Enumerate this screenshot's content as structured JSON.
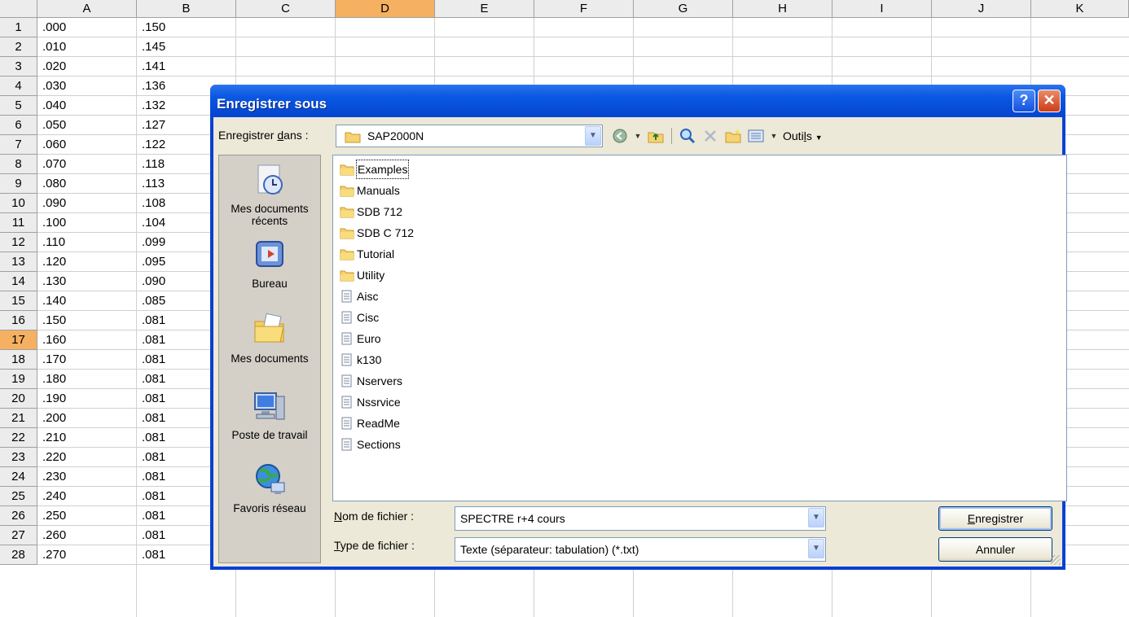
{
  "sheet": {
    "columns": [
      "A",
      "B",
      "C",
      "D",
      "E",
      "F",
      "G",
      "H",
      "I",
      "J",
      "K"
    ],
    "selected_column": "D",
    "selected_row": "17",
    "rows": [
      {
        "num": "1",
        "a": ".000",
        "b": ".150"
      },
      {
        "num": "2",
        "a": ".010",
        "b": ".145"
      },
      {
        "num": "3",
        "a": ".020",
        "b": ".141"
      },
      {
        "num": "4",
        "a": ".030",
        "b": ".136"
      },
      {
        "num": "5",
        "a": ".040",
        "b": ".132"
      },
      {
        "num": "6",
        "a": ".050",
        "b": ".127"
      },
      {
        "num": "7",
        "a": ".060",
        "b": ".122"
      },
      {
        "num": "8",
        "a": ".070",
        "b": ".118"
      },
      {
        "num": "9",
        "a": ".080",
        "b": ".113"
      },
      {
        "num": "10",
        "a": ".090",
        "b": ".108"
      },
      {
        "num": "11",
        "a": ".100",
        "b": ".104"
      },
      {
        "num": "12",
        "a": ".110",
        "b": ".099"
      },
      {
        "num": "13",
        "a": ".120",
        "b": ".095"
      },
      {
        "num": "14",
        "a": ".130",
        "b": ".090"
      },
      {
        "num": "15",
        "a": ".140",
        "b": ".085"
      },
      {
        "num": "16",
        "a": ".150",
        "b": ".081"
      },
      {
        "num": "17",
        "a": ".160",
        "b": ".081"
      },
      {
        "num": "18",
        "a": ".170",
        "b": ".081"
      },
      {
        "num": "19",
        "a": ".180",
        "b": ".081"
      },
      {
        "num": "20",
        "a": ".190",
        "b": ".081"
      },
      {
        "num": "21",
        "a": ".200",
        "b": ".081"
      },
      {
        "num": "22",
        "a": ".210",
        "b": ".081"
      },
      {
        "num": "23",
        "a": ".220",
        "b": ".081"
      },
      {
        "num": "24",
        "a": ".230",
        "b": ".081"
      },
      {
        "num": "25",
        "a": ".240",
        "b": ".081"
      },
      {
        "num": "26",
        "a": ".250",
        "b": ".081"
      },
      {
        "num": "27",
        "a": ".260",
        "b": ".081"
      },
      {
        "num": "28",
        "a": ".270",
        "b": ".081"
      }
    ]
  },
  "dialog": {
    "title": "Enregistrer sous",
    "help_glyph": "?",
    "close_glyph": "✕",
    "save_in_label_pre": "Enregistrer ",
    "save_in_label_u": "d",
    "save_in_label_post": "ans :",
    "save_in_value": "SAP2000N",
    "tools_label_pre": "Outi",
    "tools_label_u": "l",
    "tools_label_post": "s",
    "places": [
      {
        "label": "Mes documents récents",
        "icon": "recent-documents-icon"
      },
      {
        "label": "Bureau",
        "icon": "desktop-icon"
      },
      {
        "label": "Mes documents",
        "icon": "my-documents-icon"
      },
      {
        "label": "Poste de travail",
        "icon": "my-computer-icon"
      },
      {
        "label": "Favoris réseau",
        "icon": "network-places-icon"
      }
    ],
    "files": [
      {
        "name": "Examples",
        "type": "folder"
      },
      {
        "name": "Manuals",
        "type": "folder"
      },
      {
        "name": "SDB 712",
        "type": "folder"
      },
      {
        "name": "SDB C 712",
        "type": "folder"
      },
      {
        "name": "Tutorial",
        "type": "folder"
      },
      {
        "name": "Utility",
        "type": "folder"
      },
      {
        "name": "Aisc",
        "type": "file"
      },
      {
        "name": "Cisc",
        "type": "file"
      },
      {
        "name": "Euro",
        "type": "file"
      },
      {
        "name": "k130",
        "type": "file"
      },
      {
        "name": "Nservers",
        "type": "file"
      },
      {
        "name": "Nssrvice",
        "type": "file"
      },
      {
        "name": "ReadMe",
        "type": "file"
      },
      {
        "name": "Sections",
        "type": "file"
      }
    ],
    "filename_label_u": "N",
    "filename_label_post": "om de fichier :",
    "filename_value": "SPECTRE r+4 cours",
    "filetype_label_u": "T",
    "filetype_label_post": "ype de fichier :",
    "filetype_value": "Texte (séparateur: tabulation) (*.txt)",
    "save_button_u": "E",
    "save_button_post": "nregistrer",
    "cancel_button": "Annuler"
  }
}
